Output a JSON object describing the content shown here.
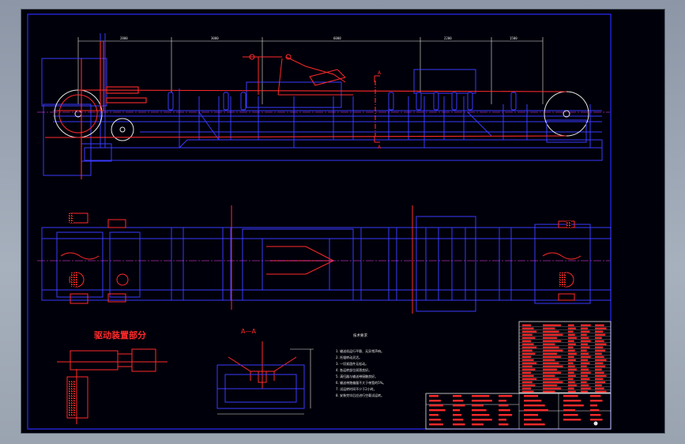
{
  "window": {
    "accent": "#0000ff"
  },
  "colors": {
    "frame": "#2a2aff",
    "structure": "#3a3aff",
    "red": "#ff2a2a",
    "white": "#e8e8e8",
    "magenta": "#ff40ff",
    "background": "#00000a"
  },
  "drawing": {
    "drive_detail_title": "驱动装置部分",
    "section_label": "A—A",
    "section_marker": "A",
    "notes_title": "技术要求",
    "notes_subtitle": "",
    "notes": [
      "1. 输送机运行平稳、无异常声响。",
      "2. 托辊转动灵活。",
      "3. 一切紧固件无松动。",
      "4. 各运转部位润滑良好。",
      "5. 清扫器与输送带接触良好。",
      "6. 输送带跑偏量不大于带宽的5%。",
      "7. 试运转时间不少于2小时。",
      "8. 安装完毕后应进行空载试运转。"
    ]
  }
}
